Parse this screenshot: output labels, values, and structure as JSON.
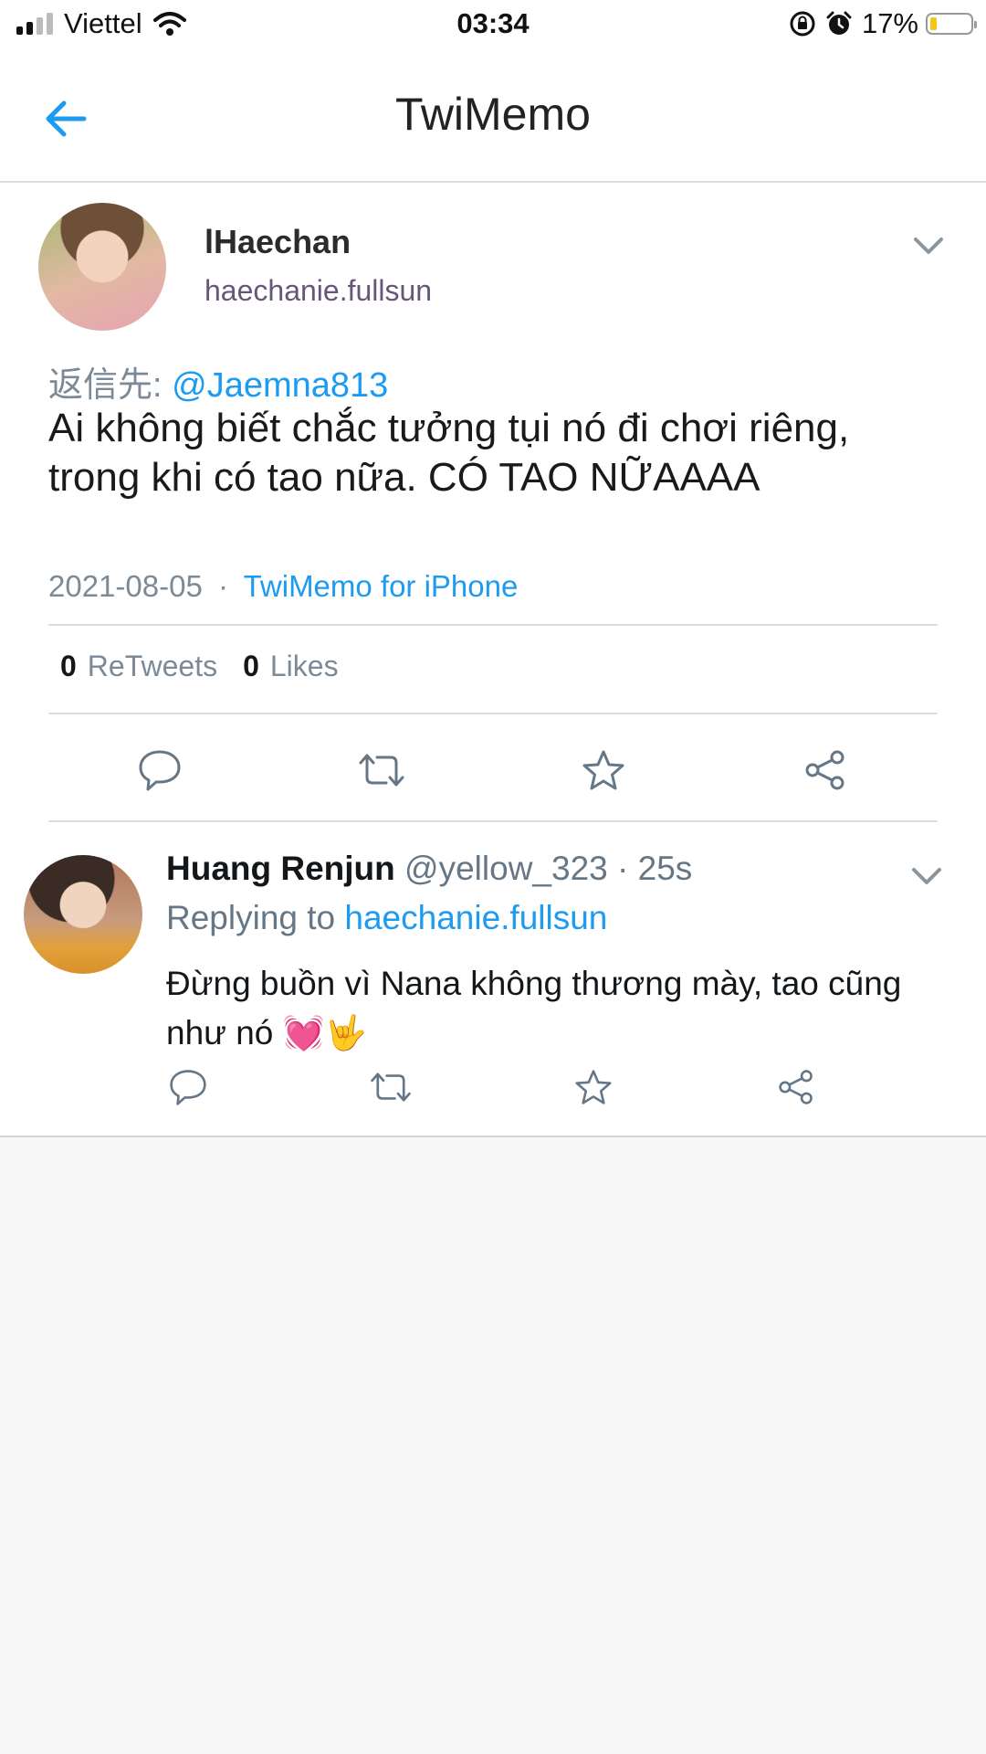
{
  "status_bar": {
    "carrier": "Viettel",
    "time": "03:34",
    "battery": "17%",
    "battery_level": 0.17
  },
  "header": {
    "title": "TwiMemo"
  },
  "tweet": {
    "author_name": "lHaechan",
    "author_handle": "haechanie.fullsun",
    "reply_prefix": "返信先:",
    "reply_to": "@Jaemna813",
    "text": "Ai không biết chắc tưởng tụi nó đi chơi riêng, trong khi có tao nữa. CÓ TAO NỮAAAA",
    "date": "2021-08-05",
    "separator": "·",
    "source": "TwiMemo for iPhone",
    "retweets_count": "0",
    "retweets_label": "ReTweets",
    "likes_count": "0",
    "likes_label": "Likes"
  },
  "reply": {
    "author_name": "Huang Renjun",
    "author_handle": "@yellow_323",
    "separator": "·",
    "time_ago": "25s",
    "replying_label": "Replying to",
    "replying_to": "haechanie.fullsun",
    "text": "Đừng buồn vì Nana không thương mày, tao cũng như nó 💓🤟"
  },
  "icons": {
    "back": "arrow-left-icon",
    "caret": "chevron-down-icon",
    "reply": "speech-bubble-icon",
    "retweet": "retweet-icon",
    "like": "star-icon",
    "share": "share-icon"
  },
  "colors": {
    "accent": "#1d9bf0",
    "muted": "#7b8a96",
    "battery_fill": "#f5c518",
    "background": "#f7f7f7"
  }
}
